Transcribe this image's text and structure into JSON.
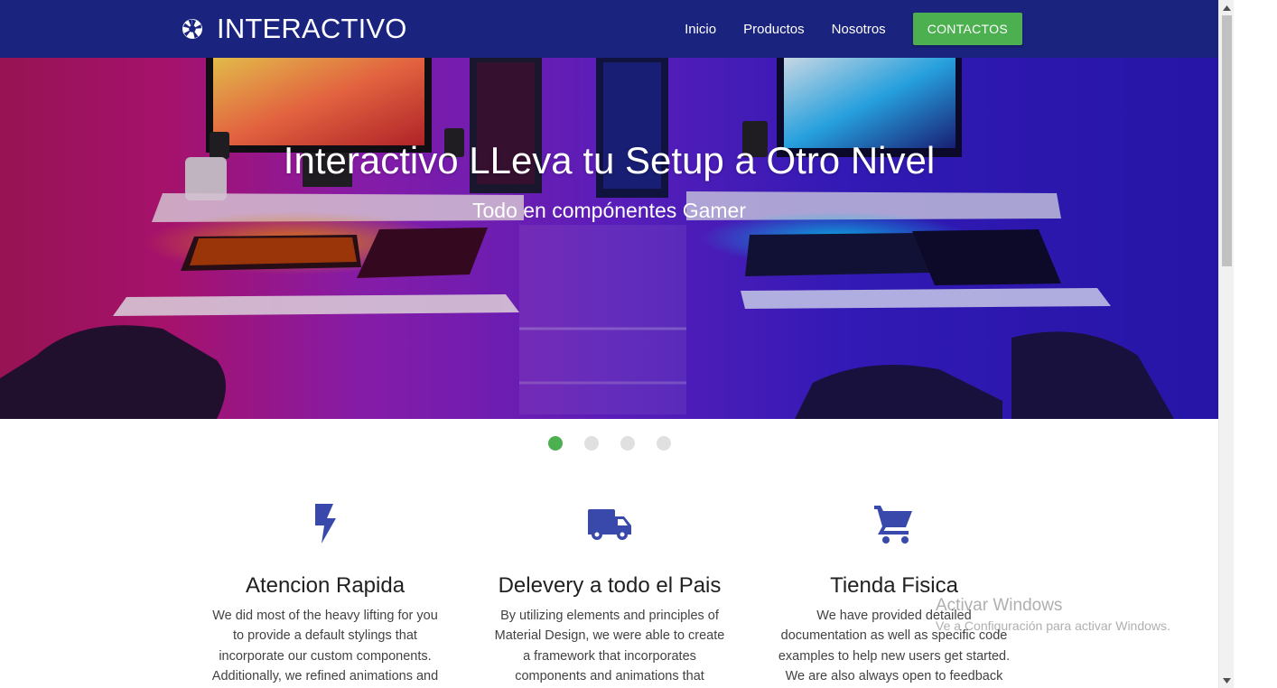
{
  "nav": {
    "brand": "INTERACTIVO",
    "links": [
      "Inicio",
      "Productos",
      "Nosotros"
    ],
    "cta": "CONTACTOS"
  },
  "hero": {
    "title": "Interactivo LLeva tu Setup a Otro Nivel",
    "subtitle": "Todo en compónentes Gamer"
  },
  "carousel": {
    "slides": 4,
    "active_index": 0
  },
  "features": [
    {
      "icon": "flash-icon",
      "title": "Atencion Rapida",
      "text": "We did most of the heavy lifting for you to provide a default stylings that incorporate our custom components. Additionally, we refined animations and"
    },
    {
      "icon": "truck-icon",
      "title": "Delevery a todo el Pais",
      "text": "By utilizing elements and principles of Material Design, we were able to create a framework that incorporates components and animations that provide more"
    },
    {
      "icon": "cart-icon",
      "title": "Tienda Fisica",
      "text": "We have provided detailed documentation as well as specific code examples to help new users get started. We are also always open to feedback and"
    }
  ],
  "watermark": {
    "line1": "Activar Windows",
    "line2": "Ve a Configuración para activar Windows."
  },
  "colors": {
    "nav": "#1a237e",
    "accent": "#4caf50",
    "icon": "#3949ab"
  }
}
